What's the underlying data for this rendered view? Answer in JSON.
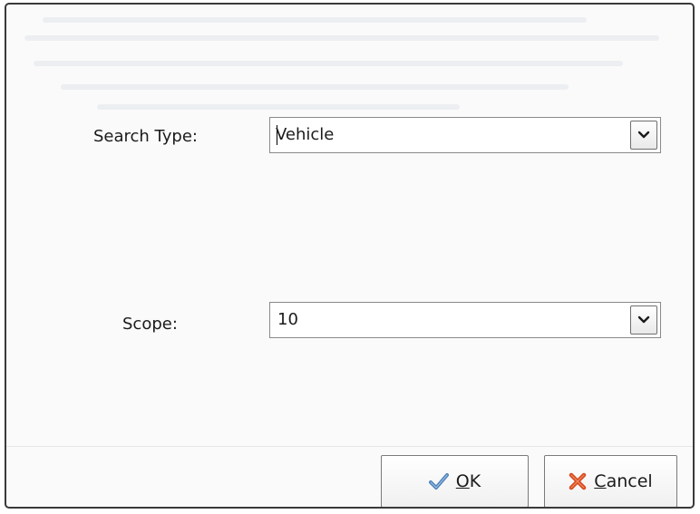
{
  "dialog": {
    "search_type": {
      "label": "Search Type:",
      "value": "Vehicle"
    },
    "scope": {
      "label": "Scope:",
      "value": "10"
    },
    "buttons": {
      "ok": {
        "mnemonic": "O",
        "rest": "K",
        "icon": "checkmark-icon"
      },
      "cancel": {
        "mnemonic": "C",
        "rest": "ancel",
        "icon": "red-x-icon"
      }
    }
  },
  "colors": {
    "ok_icon": "#4b7fb8",
    "cancel_icon": "#d64a1f",
    "border": "#3a3a3a"
  }
}
